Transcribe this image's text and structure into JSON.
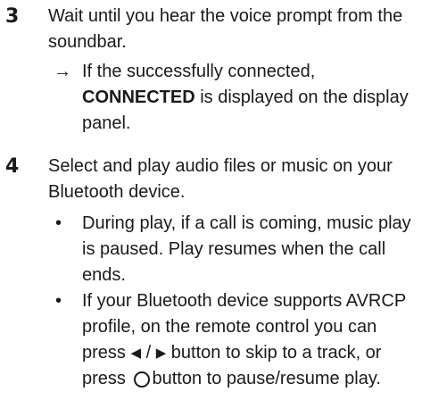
{
  "steps": [
    {
      "number": "3",
      "text": "Wait until you hear the voice prompt from the soundbar.",
      "result": {
        "arrow": "→",
        "before": "If the successfully connected, ",
        "bold": "CONNECTED",
        "after": " is displayed on the display panel."
      }
    },
    {
      "number": "4",
      "text": "Select and play audio files or music on your Bluetooth device.",
      "bullets": [
        {
          "text": "During play, if a call is coming, music play is paused. Play resumes when the call ends."
        },
        {
          "text_1": "If your Bluetooth device supports AVRCP profile, on the remote control you can press ",
          "glyph_prev": "◀",
          "separator": " / ",
          "glyph_next": "▶",
          "text_2": " button to skip to a track, or press ",
          "glyph_play_pause": "circle-button-icon",
          "text_3": "button to pause/resume play."
        }
      ],
      "bullet_symbol": "•"
    }
  ]
}
